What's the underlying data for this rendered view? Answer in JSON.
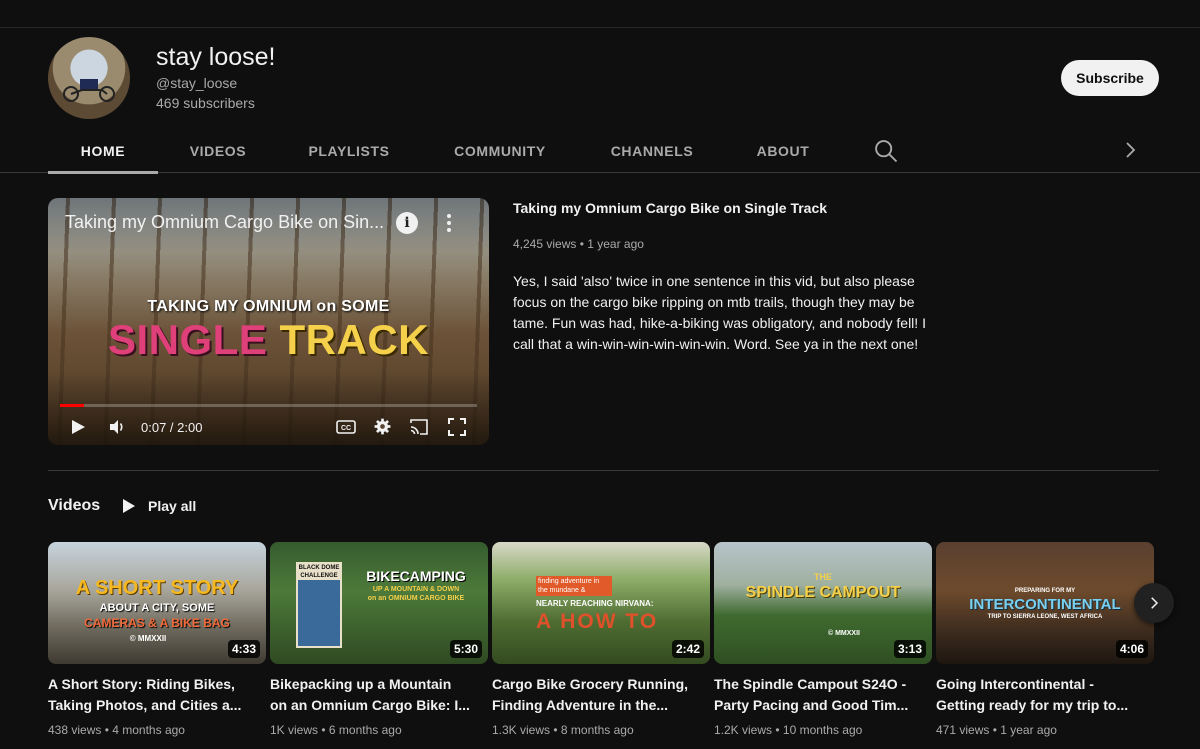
{
  "channel": {
    "name": "stay loose!",
    "handle": "@stay_loose",
    "subscribers": "469 subscribers",
    "subscribe_label": "Subscribe"
  },
  "tabs": [
    {
      "label": "HOME",
      "active": true
    },
    {
      "label": "VIDEOS",
      "active": false
    },
    {
      "label": "PLAYLISTS",
      "active": false
    },
    {
      "label": "COMMUNITY",
      "active": false
    },
    {
      "label": "CHANNELS",
      "active": false
    },
    {
      "label": "ABOUT",
      "active": false
    }
  ],
  "featured": {
    "player_title": "Taking my Omnium Cargo Bike on Sin...",
    "overlay_line1": "TAKING MY OMNIUM on SOME",
    "overlay_word1": "SINGLE",
    "overlay_word2": "TRACK",
    "time": "0:07 / 2:00",
    "progress": 0.058,
    "title": "Taking my Omnium Cargo Bike on Single Track",
    "meta": "4,245 views • 1 year ago",
    "description": "Yes, I said 'also' twice in one sentence in this vid, but also please focus on the cargo bike ripping on mtb trails, though they may be tame. Fun was had, hike-a-biking was obligatory, and nobody fell! I call that a win-win-win-win-win-win. Word. See ya in the next one!"
  },
  "videos_section": {
    "title": "Videos",
    "play_all": "Play all"
  },
  "videos": [
    {
      "title_line1": "A Short Story: Riding Bikes,",
      "title_line2": "Taking Photos, and Cities a...",
      "duration": "4:33",
      "views": "438 views",
      "age": "4 months ago",
      "thumb_text1": "A SHORT STORY",
      "thumb_text2": "ABOUT A CITY, SOME",
      "thumb_text3": "CAMERAS & A BIKE BAG",
      "thumb_text4": "© MMXXII"
    },
    {
      "title_line1": "Bikepacking up a Mountain",
      "title_line2": "on an Omnium Cargo Bike: I...",
      "duration": "5:30",
      "views": "1K views",
      "age": "6 months ago",
      "thumb_text1": "BIKECAMPING",
      "thumb_text2": "UP A MOUNTAIN & DOWN",
      "thumb_text3": "on an OMNIUM CARGO BIKE",
      "thumb_text4": "BLACK DOME CHALLENGE"
    },
    {
      "title_line1": "Cargo Bike Grocery Running,",
      "title_line2": "Finding Adventure in the...",
      "duration": "2:42",
      "views": "1.3K views",
      "age": "8 months ago",
      "thumb_text1": "finding adventure in the mundane &",
      "thumb_text2": "NEARLY REACHING NIRVANA:",
      "thumb_text3": "A HOW TO"
    },
    {
      "title_line1": "The Spindle Campout S24O -",
      "title_line2": "Party Pacing and Good Tim...",
      "duration": "3:13",
      "views": "1.2K views",
      "age": "10 months ago",
      "thumb_text1": "THE",
      "thumb_text2": "SPINDLE CAMPOUT",
      "thumb_text3": "© MMXXII"
    },
    {
      "title_line1": "Going Intercontinental -",
      "title_line2": "Getting ready for my trip to...",
      "duration": "4:06",
      "views": "471 views",
      "age": "1 year ago",
      "thumb_text1": "PREPARING FOR MY",
      "thumb_text2": "INTERCONTINENTAL",
      "thumb_text3": "TRIP TO SIERRA LEONE, WEST AFRICA"
    }
  ],
  "colors": {
    "background": "#0f0f0f",
    "text": "#f1f1f1",
    "secondary_text": "#aaaaaa",
    "progress": "#ff0000",
    "subscribe_bg": "#f1f1f1"
  },
  "icons": {
    "search": "search-icon",
    "chevron_right": "chevron-right-icon",
    "play": "play-icon",
    "volume": "volume-icon",
    "captions": "captions-icon",
    "settings": "gear-icon",
    "cast": "cast-icon",
    "fullscreen": "fullscreen-icon",
    "info": "info-icon",
    "more": "more-vert-icon"
  }
}
